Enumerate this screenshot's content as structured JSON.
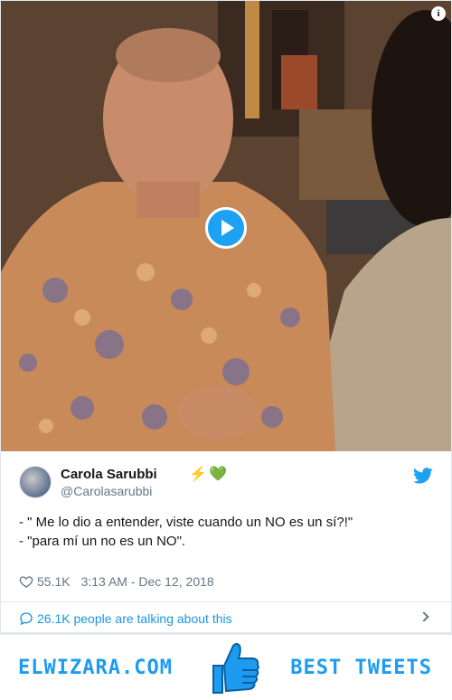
{
  "tweet": {
    "author_name": "Carola Sarubbi",
    "author_emoji_1": "⚡",
    "author_emoji_2": "💚",
    "handle": "@Carolasarubbi",
    "text_line_1": "- \" Me lo dio a entender, viste cuando un NO es un sí?!\"",
    "text_line_2": "- \"para mí un no es un NO\".",
    "likes": "55.1K",
    "timestamp": "3:13 AM - Dec 12, 2018",
    "talking": "26.1K people are talking about this"
  },
  "icons": {
    "play": "play-icon",
    "info": "info-icon",
    "twitter": "twitter-bird-icon",
    "like": "heart-icon",
    "reply": "speech-bubble-icon",
    "chevron": "chevron-right-icon",
    "thumbs_up": "thumbs-up-icon"
  },
  "banner": {
    "site": "ELWIZARA.COM",
    "tagline": "BEST TWEETS"
  },
  "colors": {
    "accent": "#1da1f2",
    "link": "#1b95e0",
    "secondary_text": "#657786",
    "banner_text": "#1d9bf0"
  }
}
